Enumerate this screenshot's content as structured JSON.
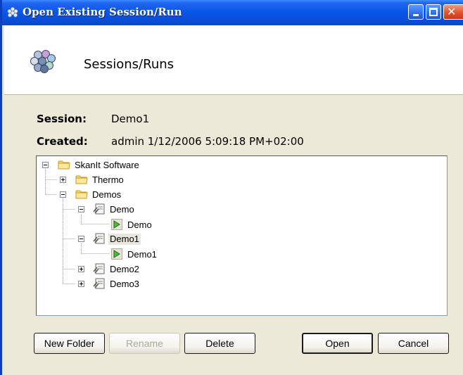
{
  "window": {
    "title": "Open Existing Session/Run"
  },
  "header": {
    "title": "Sessions/Runs"
  },
  "info": {
    "session_label": "Session:",
    "session_value": "Demo1",
    "created_label": "Created:",
    "created_value": "admin  1/12/2006 5:09:18 PM+02:00"
  },
  "tree": {
    "nodes": [
      {
        "label": "SkanIt Software",
        "type": "folder",
        "expander": "minus"
      },
      {
        "label": "Thermo",
        "type": "folder",
        "expander": "plus"
      },
      {
        "label": "Demos",
        "type": "folder",
        "expander": "minus"
      },
      {
        "label": "Demo",
        "type": "session",
        "expander": "minus"
      },
      {
        "label": "Demo",
        "type": "run"
      },
      {
        "label": "Demo1",
        "type": "session",
        "expander": "minus",
        "selected": true
      },
      {
        "label": "Demo1",
        "type": "run"
      },
      {
        "label": "Demo2",
        "type": "session",
        "expander": "plus"
      },
      {
        "label": "Demo3",
        "type": "session",
        "expander": "plus"
      }
    ]
  },
  "buttons": {
    "new_folder": "New Folder",
    "rename": "Rename",
    "delete": "Delete",
    "open": "Open",
    "cancel": "Cancel"
  },
  "colors": {
    "titlebar": "#0a58e8",
    "dialog_bg": "#ece9d8",
    "selection": "#e8e6dd"
  }
}
